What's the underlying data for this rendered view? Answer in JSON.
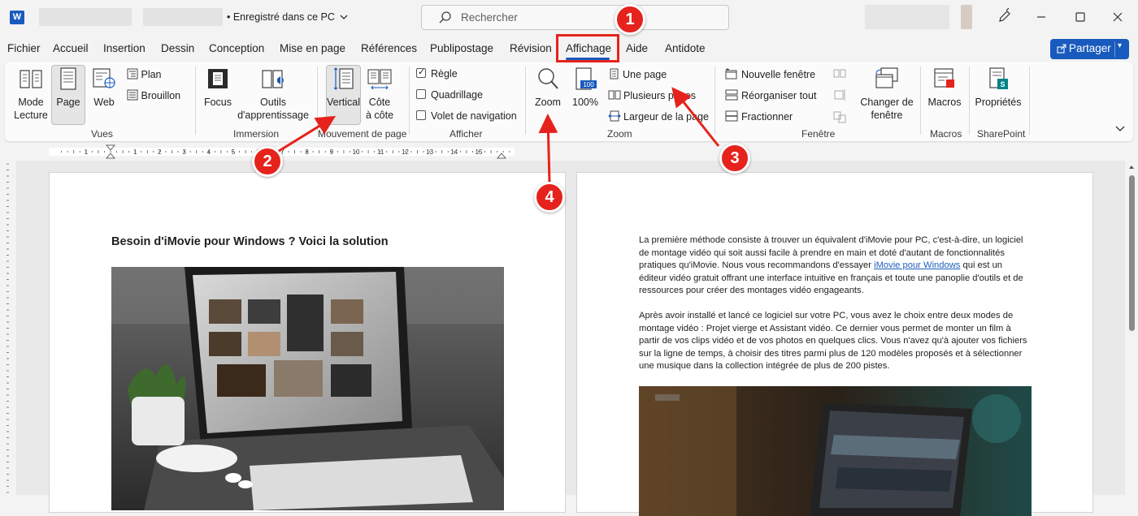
{
  "titlebar": {
    "app_logo": "W",
    "save_status": "• Enregistré dans ce PC",
    "search_placeholder": "Rechercher",
    "icons": [
      "word-logo-icon",
      "chevron-down-icon",
      "search-icon",
      "pen-icon",
      "minimize-icon",
      "maximize-icon",
      "close-icon"
    ]
  },
  "tabs": [
    {
      "label": "Fichier"
    },
    {
      "label": "Accueil"
    },
    {
      "label": "Insertion"
    },
    {
      "label": "Dessin"
    },
    {
      "label": "Conception"
    },
    {
      "label": "Mise en page"
    },
    {
      "label": "Références"
    },
    {
      "label": "Publipostage"
    },
    {
      "label": "Révision"
    },
    {
      "label": "Affichage"
    },
    {
      "label": "Aide"
    },
    {
      "label": "Antidote"
    }
  ],
  "share_button": {
    "label": "Partager"
  },
  "ribbon": {
    "vues": {
      "label": "Vues",
      "mode_lecture": "Mode\nLecture",
      "page": "Page",
      "web": "Web",
      "plan": "Plan",
      "brouillon": "Brouillon"
    },
    "immersion": {
      "label": "Immersion",
      "focus": "Focus",
      "outils": "Outils\nd'apprentissage"
    },
    "mouvement": {
      "label": "Mouvement de page",
      "vertical": "Vertical",
      "cote": "Côte\nà côte"
    },
    "afficher": {
      "label": "Afficher",
      "regle": "Règle",
      "quadrillage": "Quadrillage",
      "volet": "Volet de navigation",
      "regle_checked": true,
      "quadrillage_checked": false,
      "volet_checked": false
    },
    "zoom": {
      "label": "Zoom",
      "zoom": "Zoom",
      "pct": "100%",
      "une_page": "Une page",
      "plusieurs": "Plusieurs pages",
      "largeur": "Largeur de la page"
    },
    "fenetre": {
      "label": "Fenêtre",
      "nouvelle": "Nouvelle fenêtre",
      "reorganiser": "Réorganiser tout",
      "fractionner": "Fractionner",
      "changer": "Changer de\nfenêtre"
    },
    "macros": {
      "label": "Macros",
      "macros": "Macros"
    },
    "sharepoint": {
      "label": "SharePoint",
      "proprietes": "Propriétés"
    }
  },
  "ruler": {
    "ticks": [
      "1",
      "1",
      "2",
      "3",
      "4",
      "5",
      "6",
      "7",
      "8",
      "9",
      "10",
      "11",
      "12",
      "13",
      "14",
      "15"
    ]
  },
  "document": {
    "title": "Besoin d'iMovie pour Windows ? Voici la solution",
    "para1_a": "La première méthode consiste à trouver un équivalent d'iMovie pour PC, c'est-à-dire, un logiciel de montage vidéo qui soit aussi facile à prendre en main et doté d'autant de fonctionnalités pratiques qu'iMovie. Nous vous recommandons d'essayer ",
    "para1_link": "iMovie pour Windows",
    "para1_b": " qui est un éditeur vidéo gratuit offrant une interface intuitive en français et toute une panoplie d'outils et de ressources pour créer des montages vidéo engageants.",
    "para2": "Après avoir installé et lancé ce logiciel sur votre PC, vous avez le choix entre deux modes de montage vidéo : Projet vierge et Assistant vidéo. Ce dernier vous permet de monter un film à partir de vos clips vidéo et de vos photos en quelques clics. Vous n'avez qu'à ajouter vos fichiers sur la ligne de temps, à choisir des titres parmi plus de 120 modèles proposés et à sélectionner une musique dans la collection intégrée de plus de 200 pistes."
  },
  "annotations": {
    "b1": "1",
    "b2": "2",
    "b3": "3",
    "b4": "4"
  },
  "colors": {
    "accent": "#185abd",
    "annotation": "#e5231c"
  }
}
